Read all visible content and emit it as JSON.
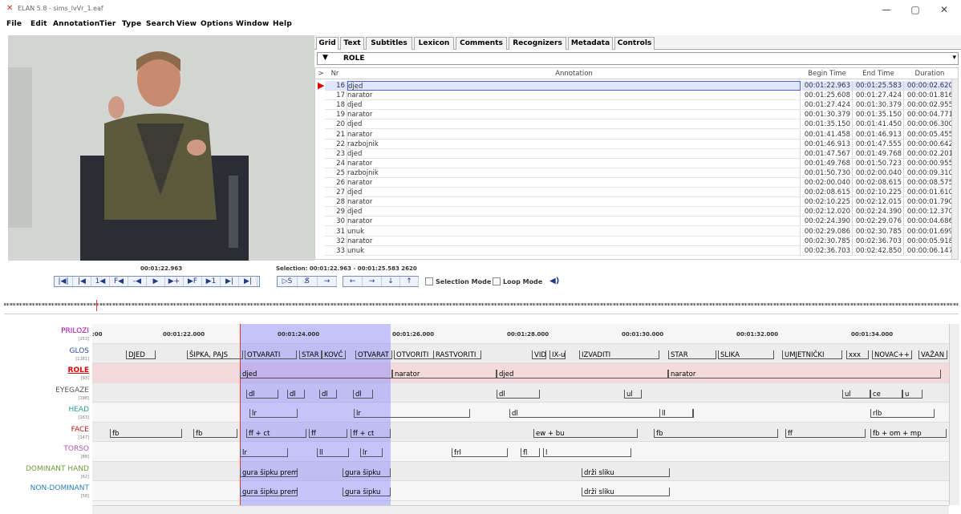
{
  "window": {
    "title": "ELAN 5.8 - sims_lvVr_1.eaf",
    "minimize": "—",
    "maximize": "▢",
    "close": "✕"
  },
  "menu": [
    "File",
    "Edit",
    "Annotation",
    "Tier",
    "Type",
    "Search",
    "View",
    "Options",
    "Window",
    "Help"
  ],
  "tabs": [
    "Grid",
    "Text",
    "Subtitles",
    "Lexicon",
    "Comments",
    "Recognizers",
    "Metadata",
    "Controls"
  ],
  "tier_select": {
    "arrow": "▼",
    "value": "ROLE",
    "dropdown": "▾"
  },
  "grid": {
    "headers": {
      "marker": ">",
      "nr": "Nr",
      "annotation": "Annotation",
      "begin": "Begin Time",
      "end": "End Time",
      "duration": "Duration"
    },
    "rows": [
      {
        "nr": "16",
        "ann": "djed",
        "begin": "00:01:22.963",
        "end": "00:01:25.583",
        "dur": "00:00:02.620"
      },
      {
        "nr": "17",
        "ann": "narator",
        "begin": "00:01:25.608",
        "end": "00:01:27.424",
        "dur": "00:00:01.816"
      },
      {
        "nr": "18",
        "ann": "djed",
        "begin": "00:01:27.424",
        "end": "00:01:30.379",
        "dur": "00:00:02.955"
      },
      {
        "nr": "19",
        "ann": "narator",
        "begin": "00:01:30.379",
        "end": "00:01:35.150",
        "dur": "00:00:04.771"
      },
      {
        "nr": "20",
        "ann": "djed",
        "begin": "00:01:35.150",
        "end": "00:01:41.450",
        "dur": "00:00:06.300"
      },
      {
        "nr": "21",
        "ann": "narator",
        "begin": "00:01:41.458",
        "end": "00:01:46.913",
        "dur": "00:00:05.455"
      },
      {
        "nr": "22",
        "ann": "razbojnik",
        "begin": "00:01:46.913",
        "end": "00:01:47.555",
        "dur": "00:00:00.642"
      },
      {
        "nr": "23",
        "ann": "djed",
        "begin": "00:01:47.567",
        "end": "00:01:49.768",
        "dur": "00:00:02.201"
      },
      {
        "nr": "24",
        "ann": "narator",
        "begin": "00:01:49.768",
        "end": "00:01:50.723",
        "dur": "00:00:00.955"
      },
      {
        "nr": "25",
        "ann": "razbojnik",
        "begin": "00:01:50.730",
        "end": "00:02:00.040",
        "dur": "00:00:09.310"
      },
      {
        "nr": "26",
        "ann": "narator",
        "begin": "00:02:00.040",
        "end": "00:02:08.615",
        "dur": "00:00:08.575"
      },
      {
        "nr": "27",
        "ann": "djed",
        "begin": "00:02:08.615",
        "end": "00:02:10.225",
        "dur": "00:00:01.610"
      },
      {
        "nr": "28",
        "ann": "narator",
        "begin": "00:02:10.225",
        "end": "00:02:12.015",
        "dur": "00:00:01.790"
      },
      {
        "nr": "29",
        "ann": "djed",
        "begin": "00:02:12.020",
        "end": "00:02:24.390",
        "dur": "00:00:12.370"
      },
      {
        "nr": "30",
        "ann": "narator",
        "begin": "00:02:24.390",
        "end": "00:02:29.076",
        "dur": "00:00:04.686"
      },
      {
        "nr": "31",
        "ann": "unuk",
        "begin": "00:02:29.086",
        "end": "00:02:30.785",
        "dur": "00:00:01.699"
      },
      {
        "nr": "32",
        "ann": "narator",
        "begin": "00:02:30.785",
        "end": "00:02:36.703",
        "dur": "00:00:05.918"
      },
      {
        "nr": "33",
        "ann": "unuk",
        "begin": "00:02:36.703",
        "end": "00:02:42.850",
        "dur": "00:00:06.147"
      }
    ]
  },
  "player": {
    "time": "00:01:22.963",
    "selection": "Selection: 00:01:22.963 - 00:01:25.583  2620",
    "buttons": [
      "|◀|",
      "|◀",
      "1◀",
      "F◀",
      "-◀",
      "▶",
      "▶+",
      "▶F",
      "▶1",
      "▶|",
      "▶|"
    ],
    "sel_buttons": [
      "▷S",
      "S̸",
      "→"
    ],
    "nav_buttons": [
      "←",
      "→",
      "↓",
      "↑"
    ],
    "selection_mode": "Selection Mode",
    "loop_mode": "Loop Mode",
    "volume_icon": "◀)"
  },
  "ticks": [
    ":00",
    "00:01:22.000",
    "00:01:24.000",
    "00:01:26.000",
    "00:01:28.000",
    "00:01:30.000",
    "00:01:32.000",
    "00:01:34.000"
  ],
  "tiers": [
    {
      "name": "PRILOZI",
      "count": "[153]",
      "color": "#a0a"
    },
    {
      "name": "GLOS",
      "count": "[1161]",
      "color": "#2a4e9c"
    },
    {
      "name": "ROLE",
      "count": "[93]",
      "color": "#d00"
    },
    {
      "name": "EYEGAZE",
      "count": "[198]",
      "color": "#555"
    },
    {
      "name": "HEAD",
      "count": "[163]",
      "color": "#2a9c9c"
    },
    {
      "name": "FACE",
      "count": "[147]",
      "color": "#b11"
    },
    {
      "name": "TORSO",
      "count": "[88]",
      "color": "#a5a"
    },
    {
      "name": "DOMINANT HAND",
      "count": "[62]",
      "color": "#6b9c3b"
    },
    {
      "name": "NON-DOMINANT",
      "count": "[58]",
      "color": "#2a7fb8"
    }
  ],
  "annotations": {
    "glos": [
      "DJED",
      "ŠIPKA, PAJS",
      "OTVARATI",
      "STAR",
      "KOVČ",
      "OTVARAT",
      "OTVORITI",
      "RASTVORITI",
      "VID",
      "IX-u",
      "IZVADITI",
      "STAR",
      "SLIKA",
      "UMJETNIČKI",
      "xxx",
      "NOVAC++",
      "VAŽAN"
    ],
    "role": [
      "djed",
      "narator",
      "djed",
      "narator"
    ],
    "eyegaze": [
      "dl",
      "dl",
      "dl",
      "dl",
      "dl",
      "ul",
      "ul",
      "ce",
      "u"
    ],
    "head": [
      "lr",
      "lr",
      "dl",
      "ll",
      "rlb"
    ],
    "face": [
      "fb",
      "fb",
      "ff + ct",
      "ff",
      "ff + ct",
      "ew + bu",
      "fb",
      "ff",
      "fb + om + mp"
    ],
    "torso": [
      "lr",
      "ll",
      "lr",
      "frl",
      "fl",
      "l"
    ],
    "dominant": [
      "gura šipku prem",
      "gura šipku",
      "drži sliku"
    ],
    "nondominant": [
      "gura šipku prem",
      "gura šipku",
      "drži sliku"
    ]
  }
}
